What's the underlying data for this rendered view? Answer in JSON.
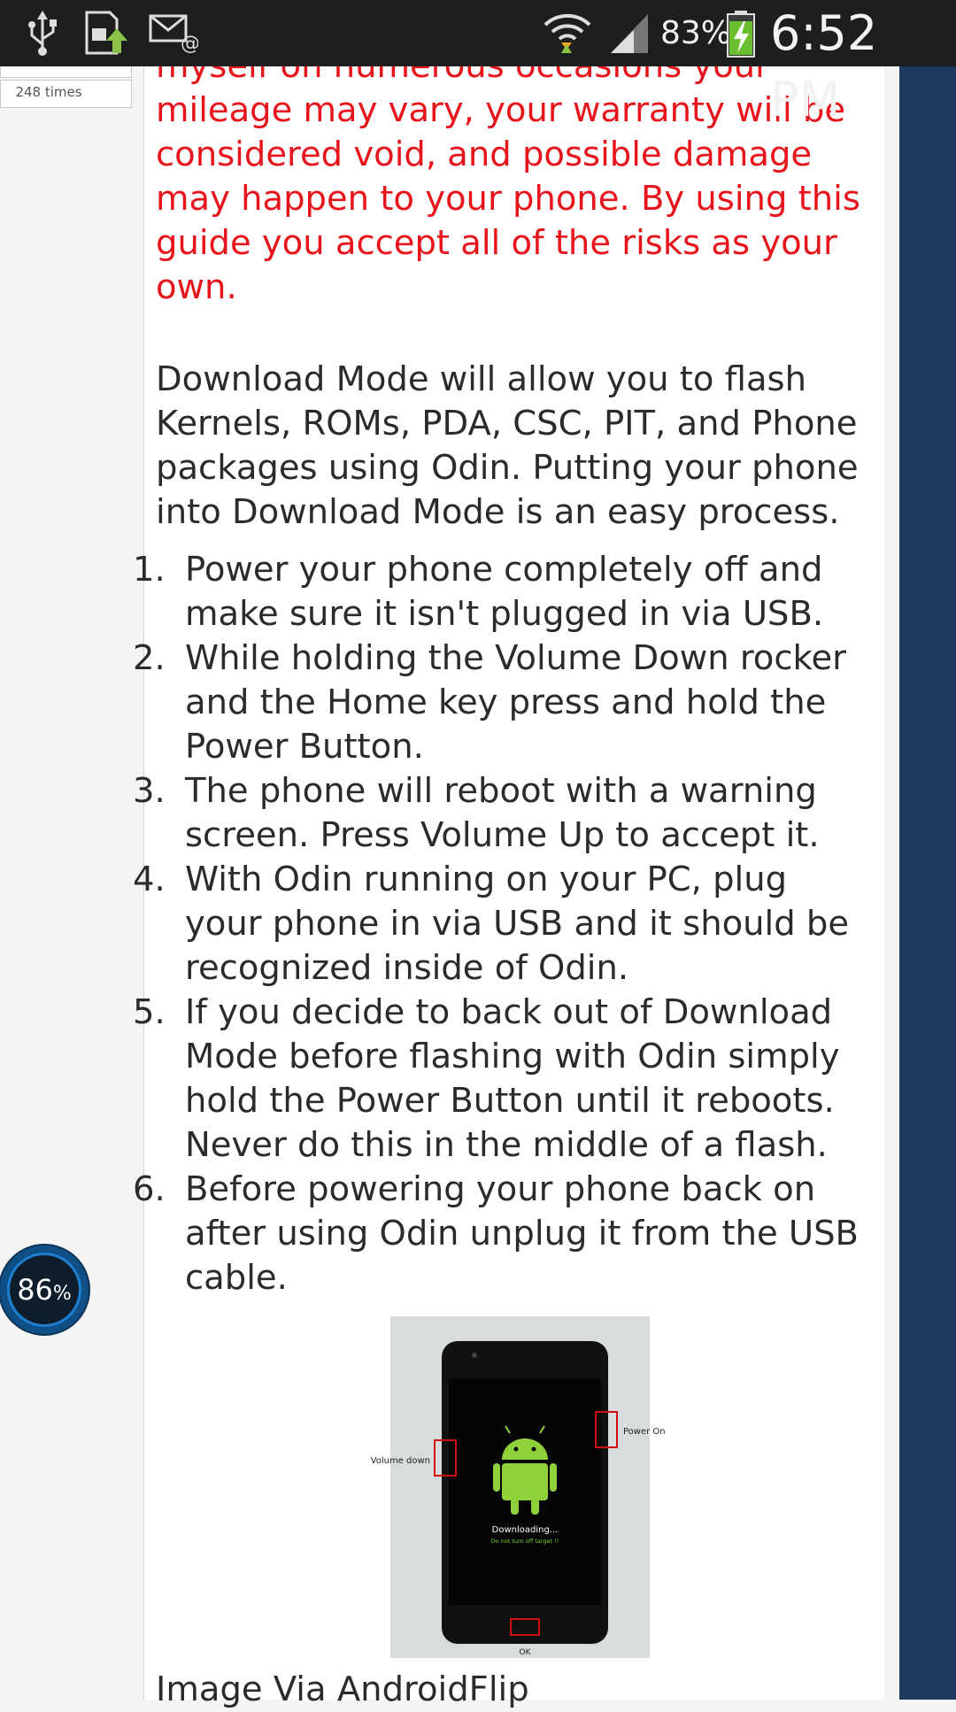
{
  "status_bar": {
    "battery_percent": "83%",
    "time": "6:52 PM",
    "icons": [
      "usb-icon",
      "file-upload-icon",
      "email-icon",
      "wifi-icon",
      "signal-icon",
      "battery-charging-icon"
    ]
  },
  "sidebar": {
    "counter_label": "248 times"
  },
  "article": {
    "warning_text": "myself on numerous occasions your mileage may vary, your warranty will be considered void, and possible damage may happen to your phone. By using this guide you accept all of the risks as your own.",
    "intro_text": "Download Mode will allow you to flash Kernels, ROMs, PDA, CSC, PIT, and Phone packages using Odin. Putting your phone into Download Mode is an easy process.",
    "steps": [
      {
        "num": "1.",
        "text": "Power your phone completely off and make sure it isn't plugged in via USB."
      },
      {
        "num": "2.",
        "text": "While holding the Volume Down rocker and the Home key press and hold the Power Button."
      },
      {
        "num": "3.",
        "text": "The phone will reboot with a warning screen. Press Volume Up to accept it."
      },
      {
        "num": "4.",
        "text": "With Odin running on your PC, plug your phone in via USB and it should be recognized inside of Odin."
      },
      {
        "num": "5.",
        "text": "If you decide to back out of Download Mode before flashing with Odin simply hold the Power Button until it reboots. Never do this in the middle of a flash."
      },
      {
        "num": "6.",
        "text": "Before powering your phone back on after using Odin unplug it from the USB cable."
      }
    ],
    "figure": {
      "label_volume_down": "Volume down",
      "label_power_on": "Power On",
      "label_ok": "OK",
      "screen_text_main": "Downloading...",
      "screen_text_sub": "Do not turn off target !!"
    },
    "caption": "Image Via AndroidFlip"
  },
  "widget": {
    "value": "86",
    "unit": "%"
  },
  "colors": {
    "warning": "#e8141b",
    "right_bar": "#1d3a5f",
    "widget_ring": "#1e7fd0"
  }
}
